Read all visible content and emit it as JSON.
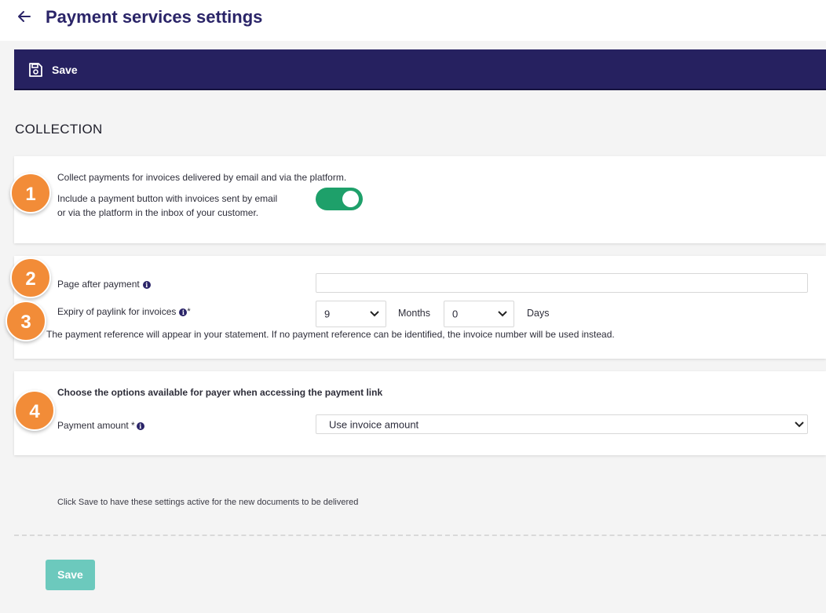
{
  "header": {
    "title": "Payment services settings",
    "back_icon": "arrow-left-icon"
  },
  "toolbar": {
    "save_label": "Save",
    "save_icon": "floppy-disk-icon",
    "background_color": "#262160"
  },
  "section": {
    "heading": "COLLECTION"
  },
  "collect": {
    "title": "Collect payments for invoices delivered by email and via the platform.",
    "description_line1": "Include a payment button with invoices sent by email",
    "description_line2": "or via the platform in the inbox of your customer.",
    "toggle_on": true,
    "toggle_color": "#1ea06a"
  },
  "paylink": {
    "page_after_payment_label": "Page after payment",
    "page_after_payment_value": "",
    "expiry_label": "Expiry of paylink for invoices",
    "expiry_required_mark": "*",
    "months_value": "9",
    "months_unit": "Months",
    "days_value": "0",
    "days_unit": "Days",
    "reference_note": "The payment reference will appear in your statement. If no payment reference can be identified, the invoice number will be used instead."
  },
  "payer_options": {
    "title": "Choose the options available for payer when accessing the payment link",
    "amount_label": "Payment amount *",
    "amount_value": "Use invoice amount"
  },
  "badges": [
    "1",
    "2",
    "3",
    "4"
  ],
  "badge_color": "#f28c38",
  "footer": {
    "note": "Click Save to have these settings active for the new documents to be delivered",
    "save_label": "Save",
    "save_color": "#6cc9bd"
  }
}
